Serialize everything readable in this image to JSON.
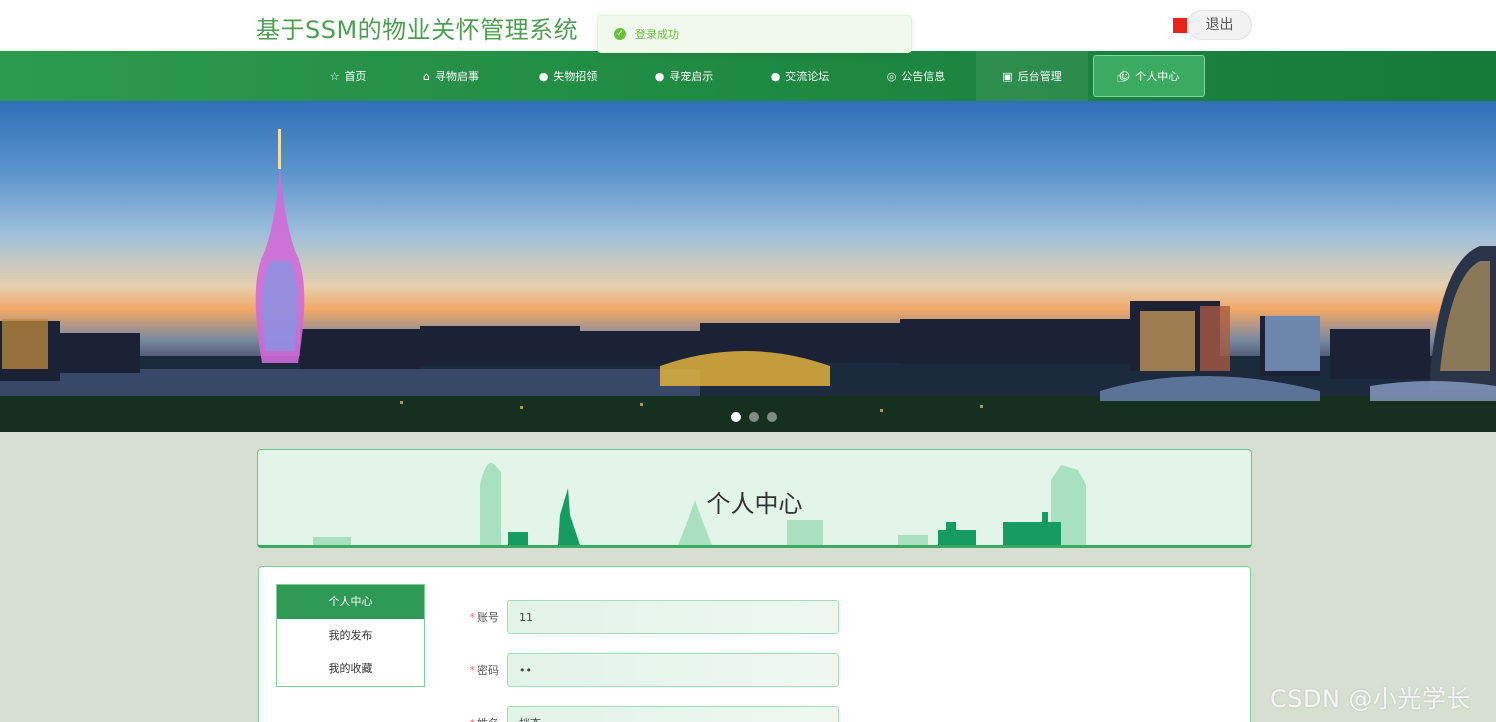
{
  "header": {
    "site_title": "基于SSM的物业关怀管理系统",
    "toast_text": "登录成功",
    "logout_label": "退出"
  },
  "nav": {
    "items": [
      {
        "label": "首页",
        "icon": "star-icon"
      },
      {
        "label": "寻物启事",
        "icon": "bag-icon"
      },
      {
        "label": "失物招领",
        "icon": "info-icon"
      },
      {
        "label": "寻宠启示",
        "icon": "info-icon"
      },
      {
        "label": "交流论坛",
        "icon": "info-icon"
      },
      {
        "label": "公告信息",
        "icon": "globe-icon"
      },
      {
        "label": "后台管理",
        "icon": "box-icon"
      },
      {
        "label": "个人中心",
        "icon": "user-icon",
        "active": true
      }
    ]
  },
  "banner": {
    "slide_count": 3,
    "active_slide": 1
  },
  "page": {
    "title": "个人中心"
  },
  "side_menu": {
    "items": [
      {
        "label": "个人中心",
        "active": true
      },
      {
        "label": "我的发布"
      },
      {
        "label": "我的收藏"
      }
    ]
  },
  "form": {
    "account_label": "账号",
    "account_value": "11",
    "password_label": "密码",
    "password_value": "••",
    "name_label": "姓名",
    "name_value": "挡态"
  },
  "watermark": "CSDN @小光学长",
  "colors": {
    "brand_green": "#2e9a4d",
    "title_green": "#4e9e52",
    "success": "#67c23a"
  }
}
